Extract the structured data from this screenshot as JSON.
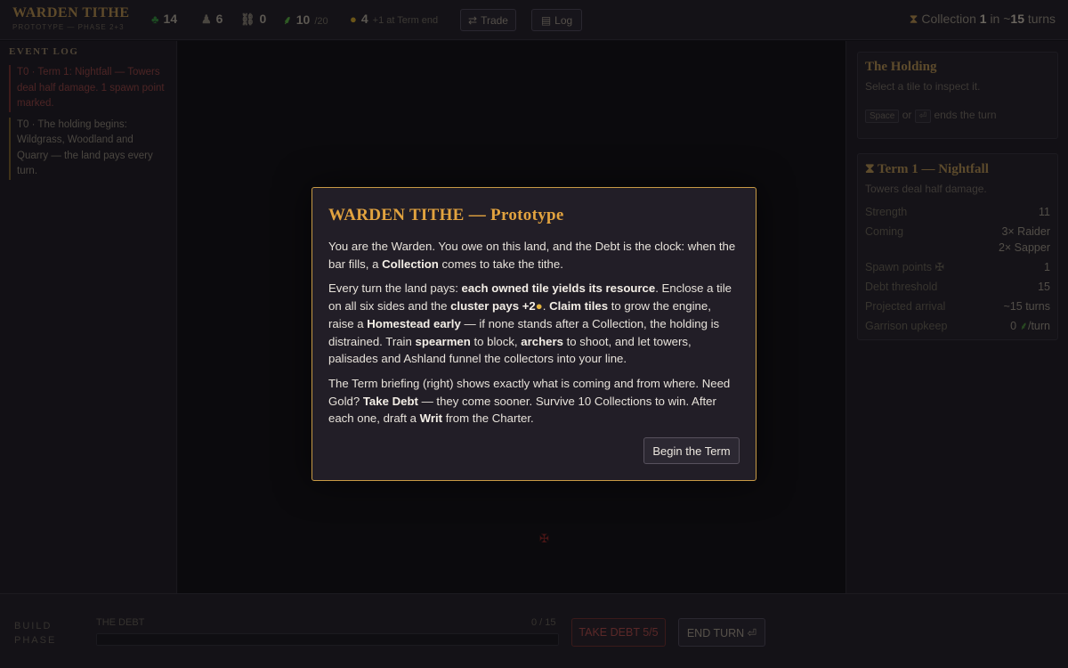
{
  "header": {
    "title": "WARDEN TITHE",
    "subtitle": "PROTOTYPE — PHASE 2+3",
    "resources": [
      {
        "icon": "tree-icon",
        "glyph": "♣",
        "value": "14"
      },
      {
        "icon": "stone-icon",
        "glyph": "♟",
        "value": "6"
      },
      {
        "icon": "chain-icon",
        "glyph": "⛓",
        "value": "0"
      },
      {
        "icon": "wheat-icon",
        "glyph": "⸙",
        "value": "10",
        "max": "/20"
      },
      {
        "icon": "gold-bag-icon",
        "glyph": "●",
        "value": "4",
        "note": "+1 at Term end"
      }
    ],
    "trade_label": "Trade",
    "log_label": "Log",
    "collection": {
      "prefix": "Collection",
      "number": "1",
      "middle": "in ~",
      "turns": "15",
      "suffix": "turns"
    }
  },
  "event_log": {
    "heading": "EVENT LOG",
    "entries": [
      {
        "text": "T0 · Term 1: Nightfall — Towers deal half damage. 1 spawn point marked."
      },
      {
        "text": "T0 · The holding begins: Wildgrass, Woodland and Quarry — the land pays every turn."
      }
    ]
  },
  "holding": {
    "title": "The Holding",
    "hint": "Select a tile to inspect it.",
    "key1": "Space",
    "or": "or",
    "key2": "⏎",
    "ends": "ends the turn"
  },
  "term": {
    "title": "Term 1 — Nightfall",
    "desc": "Towers deal half damage.",
    "stats": [
      {
        "k": "Strength",
        "v": "11"
      },
      {
        "k": "Coming",
        "v": "3× Raider",
        "v2": "2× Sapper"
      },
      {
        "k": "Spawn points",
        "v": "1"
      },
      {
        "k": "Debt threshold",
        "v": "15"
      },
      {
        "k": "Projected arrival",
        "v": "~15 turns"
      },
      {
        "k": "Garrison upkeep",
        "v": "0",
        "unit": "/turn"
      }
    ]
  },
  "bottom": {
    "phase_line1": "BUILD",
    "phase_line2": "PHASE",
    "debt_label": "THE DEBT",
    "debt_count": "0 / 15",
    "debt_progress": 0,
    "take_debt": "TAKE DEBT 5/5",
    "end_turn": "END TURN ⏎"
  },
  "modal": {
    "title": "WARDEN TITHE — Prototype",
    "p1_a": "You are the Warden. You owe on this land, and the Debt is the clock: when the bar fills, a ",
    "p1_b": "Collection",
    "p1_c": " comes to take the tithe.",
    "p2_a": "Every turn the land pays: ",
    "p2_b": "each owned tile yields its resource",
    "p2_c": ". Enclose a tile on all six sides and the ",
    "p2_d": "cluster pays +2",
    "p2_e": ". ",
    "p2_f": "Claim tiles",
    "p2_g": " to grow the engine, raise a ",
    "p2_h": "Homestead early",
    "p2_i": " — if none stands after a Collection, the holding is distrained. Train ",
    "p2_j": "spearmen",
    "p2_k": " to block, ",
    "p2_l": "archers",
    "p2_m": " to shoot, and let towers, palisades and Ashland funnel the collectors into your line.",
    "p3_a": "The Term briefing (right) shows exactly what is coming and from where. Need Gold? ",
    "p3_b": "Take Debt",
    "p3_c": " — they come sooner. Survive 10 Collections to win. After each one, draft a ",
    "p3_d": "Writ",
    "p3_e": " from the Charter.",
    "button": "Begin the Term"
  },
  "colors": {
    "accent": "#e2a33f",
    "modal_border": "#c89a45",
    "danger": "#8a2a2a"
  }
}
